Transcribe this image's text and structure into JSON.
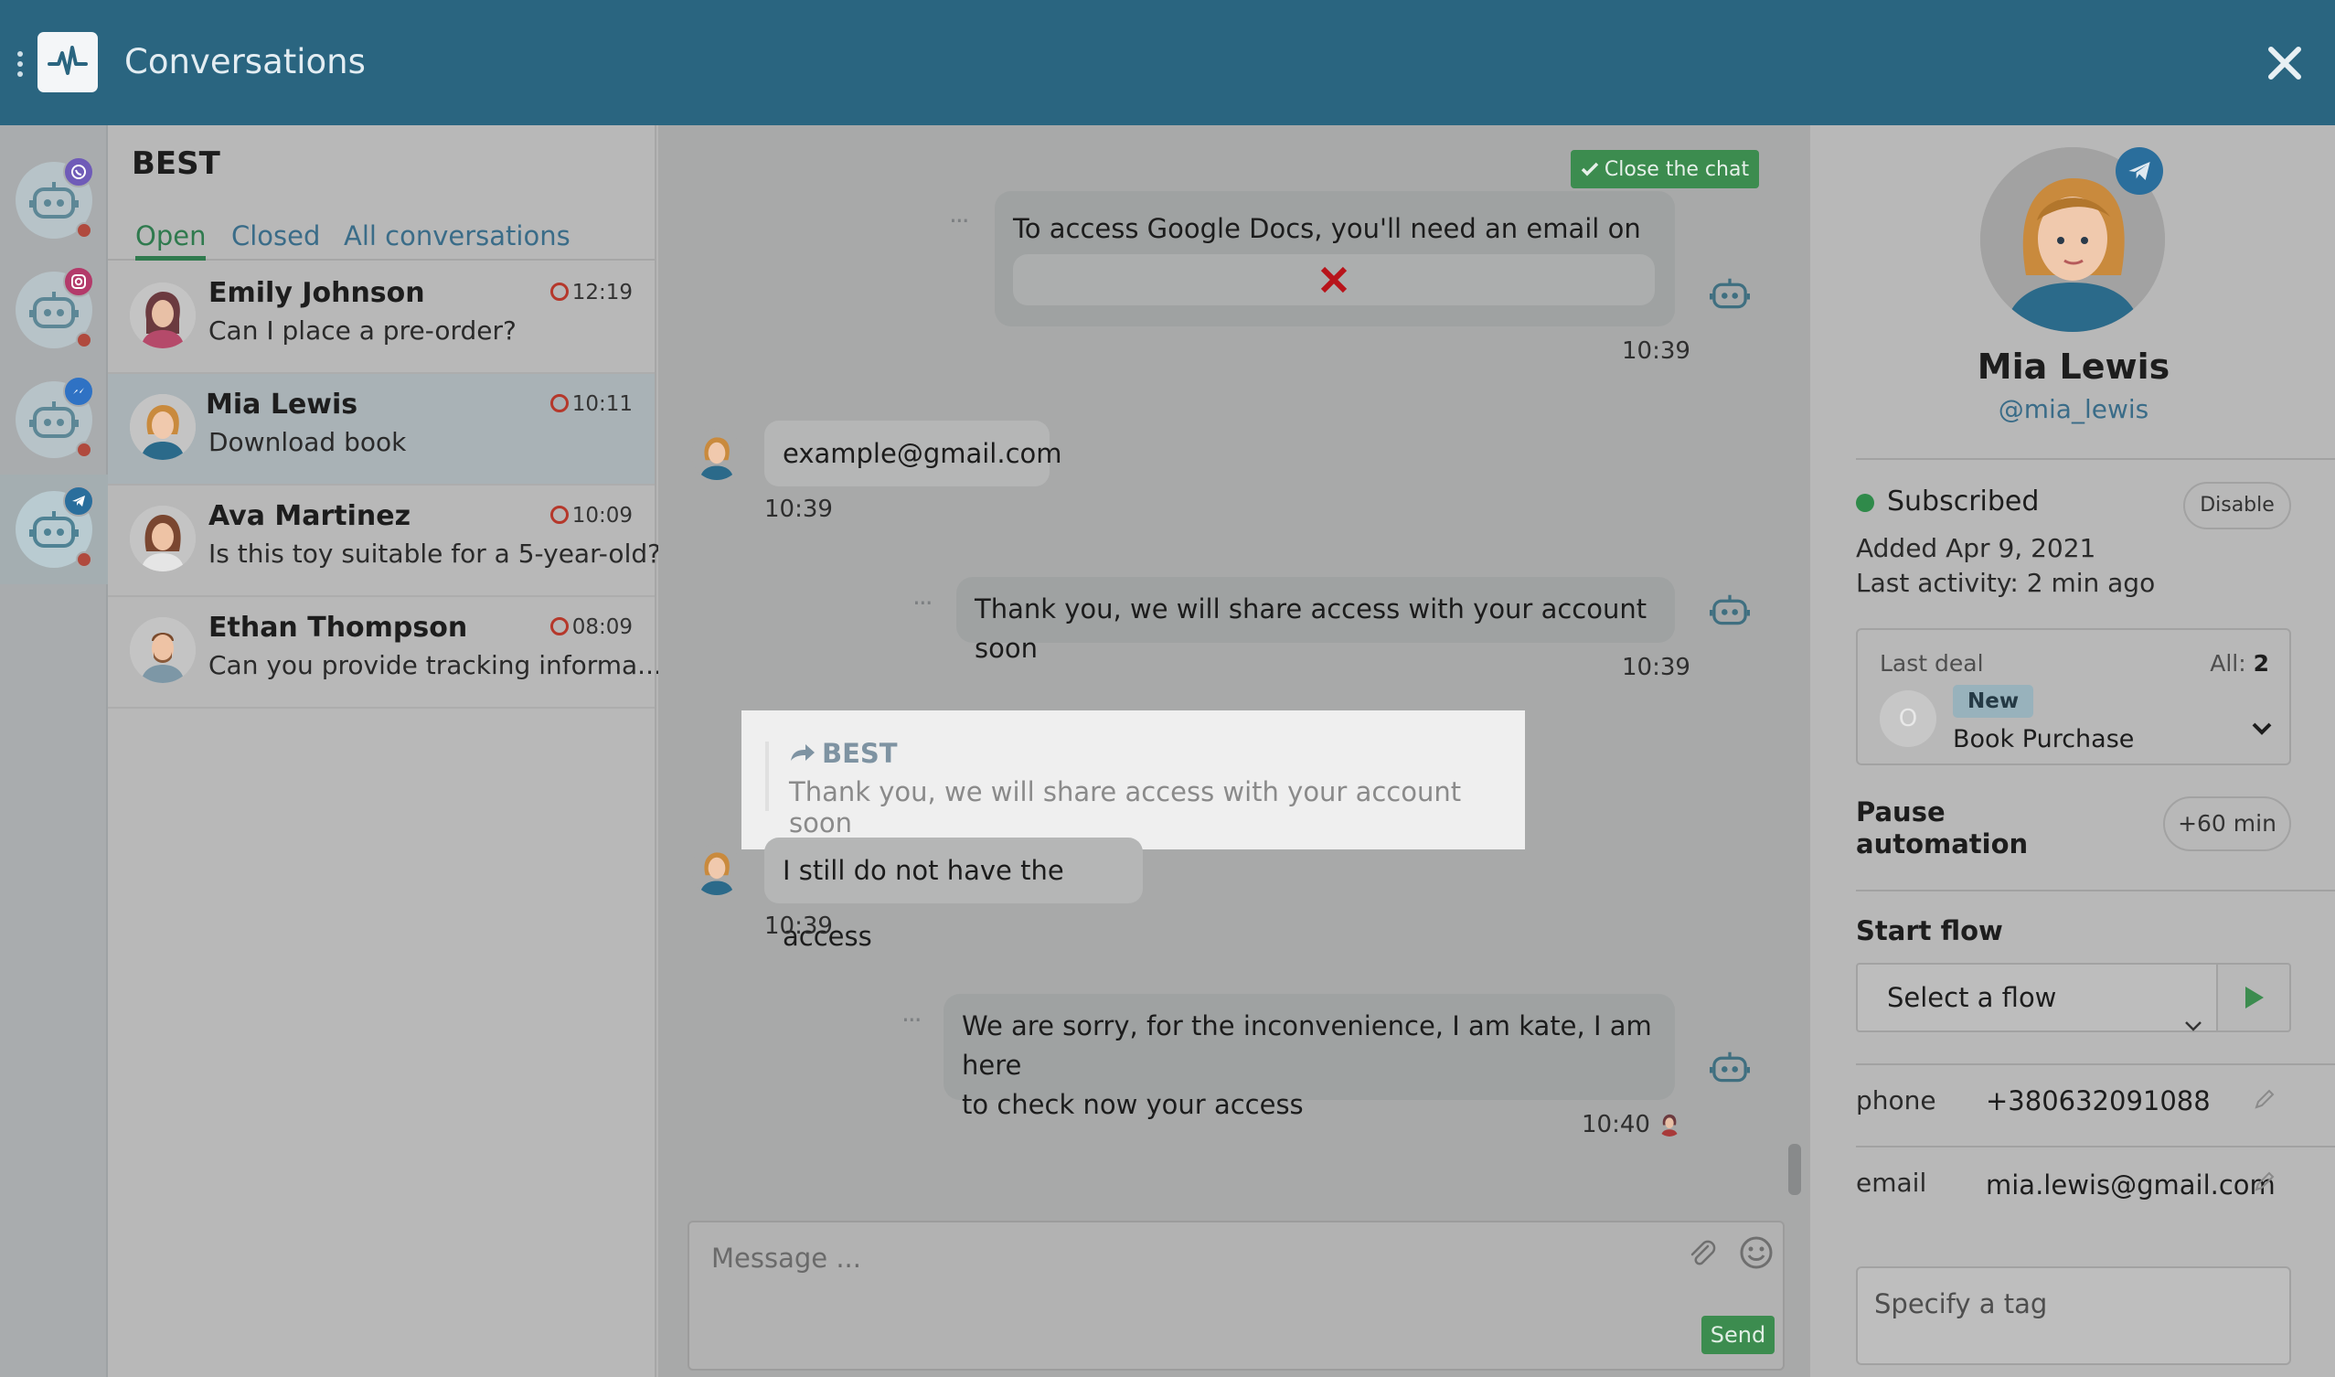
{
  "header": {
    "title": "Conversations"
  },
  "rail": {
    "channels": [
      {
        "network": "viber",
        "badge_color": "#6f5bb8",
        "active": false
      },
      {
        "network": "instagram",
        "badge_color": "#b33a6a",
        "active": false
      },
      {
        "network": "messenger",
        "badge_color": "#2f72c4",
        "active": false
      },
      {
        "network": "telegram",
        "badge_color": "#2a6e9c",
        "active": true
      }
    ]
  },
  "conversation_list": {
    "bot_name": "BEST",
    "tabs": [
      "Open",
      "Closed",
      "All conversations"
    ],
    "active_tab": "Open",
    "items": [
      {
        "name": "Emily Johnson",
        "preview": "Can I place a pre-order?",
        "time": "12:19",
        "selected": false
      },
      {
        "name": "Mia Lewis",
        "preview": "Download book",
        "time": "10:11",
        "selected": true
      },
      {
        "name": "Ava Martinez",
        "preview": "Is this toy suitable for a 5-year-old?",
        "time": "10:09",
        "selected": false
      },
      {
        "name": "Ethan Thompson",
        "preview": "Can you provide tracking informa...",
        "time": "08:09",
        "selected": false
      }
    ]
  },
  "chat": {
    "close_label": "Close the chat",
    "messages": [
      {
        "dir": "out",
        "text": "To access Google Docs, you'll need an email on gmail",
        "time": "10:39",
        "attachment": "broken-image"
      },
      {
        "dir": "in",
        "text": "example@gmail.com",
        "time": "10:39"
      },
      {
        "dir": "out",
        "text": "Thank you, we will share access with your account soon",
        "time": "10:39"
      },
      {
        "dir": "in",
        "text": "I still do not have the access",
        "time": "10:39",
        "reply_to": {
          "author": "BEST",
          "text": "Thank you, we will share access with your account soon"
        }
      },
      {
        "dir": "out",
        "text_lines": [
          "We are sorry, for the inconvenience, I am kate, I am here",
          "to check now your access"
        ],
        "time": "10:40"
      }
    ],
    "composer": {
      "placeholder": "Message ...",
      "send_label": "Send"
    }
  },
  "profile": {
    "name": "Mia Lewis",
    "username": "@mia_lewis",
    "status": "Subscribed",
    "disable_label": "Disable",
    "added": "Added Apr 9, 2021",
    "last_activity": "Last activity: 2 min ago",
    "deal": {
      "label": "Last deal",
      "all_label": "All:",
      "all_count": "2",
      "initial": "O",
      "stage": "New",
      "name": "Book Purchase"
    },
    "pause": {
      "label_line1": "Pause",
      "label_line2": "automation",
      "button": "+60 min"
    },
    "start_flow": {
      "label": "Start flow",
      "select_value": "Select a flow"
    },
    "fields": [
      {
        "key": "phone",
        "value": "+380632091088"
      },
      {
        "key": "email",
        "value": "mia.lewis@gmail.com"
      }
    ],
    "tag_placeholder": "Specify a tag"
  },
  "colors": {
    "header": "#2a6580",
    "accent_green": "#3c8c4f",
    "link": "#3a6c88"
  }
}
